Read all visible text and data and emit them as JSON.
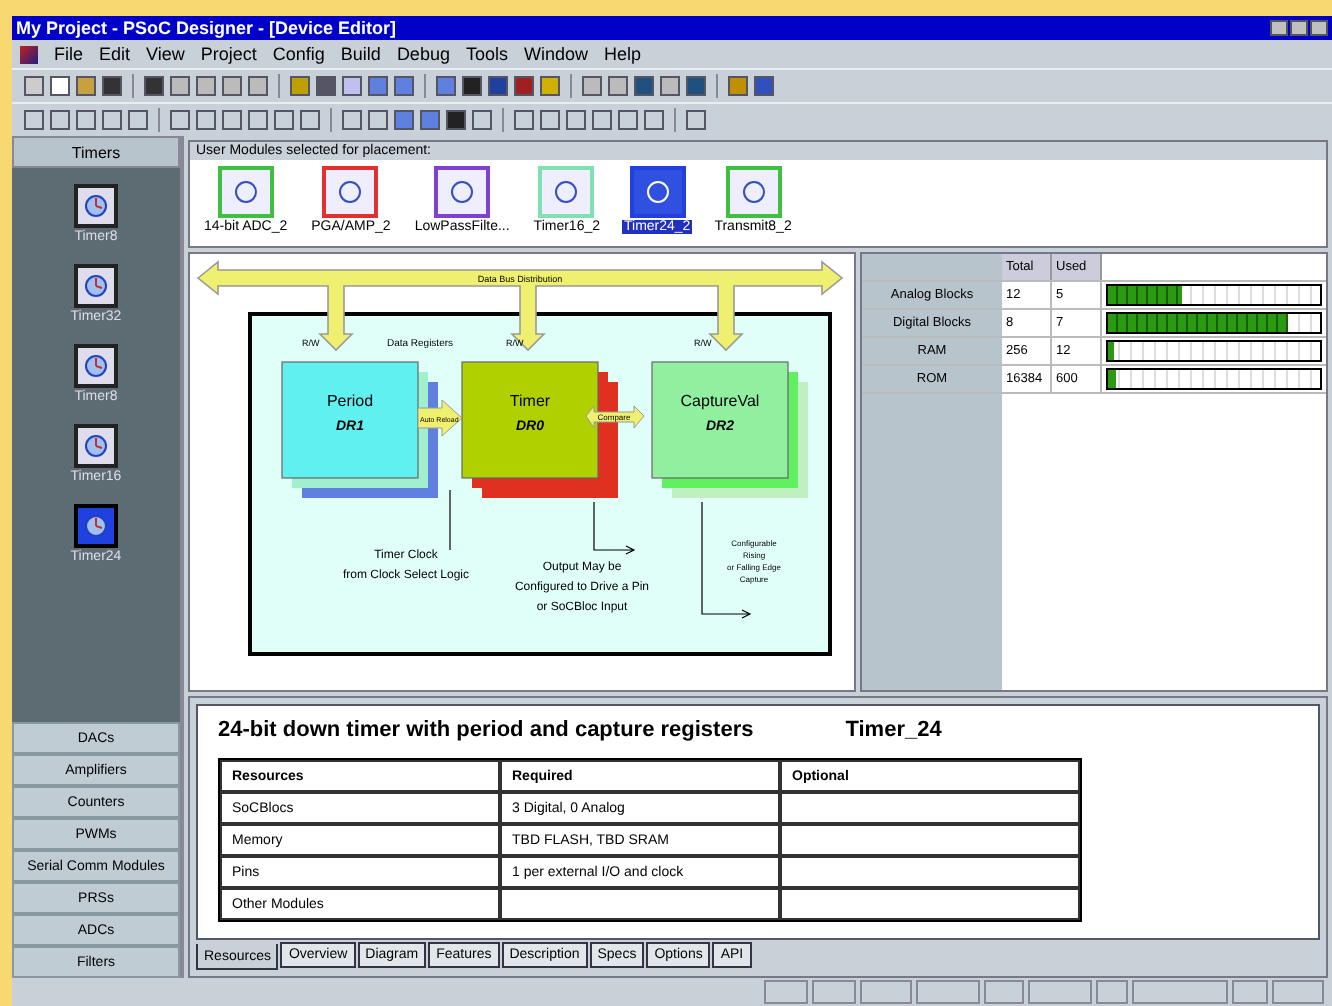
{
  "window": {
    "title": "My Project - PSoC Designer - [Device Editor]"
  },
  "menu": [
    "File",
    "Edit",
    "View",
    "Project",
    "Config",
    "Build",
    "Debug",
    "Tools",
    "Window",
    "Help"
  ],
  "sidebar": {
    "heading": "Timers",
    "items": [
      {
        "label": "Timer8",
        "selected": false
      },
      {
        "label": "Timer32",
        "selected": false
      },
      {
        "label": "Timer8",
        "selected": false
      },
      {
        "label": "Timer16",
        "selected": false
      },
      {
        "label": "Timer24",
        "selected": true
      }
    ],
    "categories": [
      "DACs",
      "Amplifiers",
      "Counters",
      "PWMs",
      "Serial Comm Modules",
      "PRSs",
      "ADCs",
      "Filters"
    ]
  },
  "modules": {
    "heading": "User Modules selected for placement:",
    "items": [
      {
        "label": "14-bit ADC_2",
        "color": "#40c040",
        "selected": false
      },
      {
        "label": "PGA/AMP_2",
        "color": "#e03030",
        "selected": false
      },
      {
        "label": "LowPassFilte...",
        "color": "#8040d0",
        "selected": false
      },
      {
        "label": "Timer16_2",
        "color": "#80e0b0",
        "selected": false
      },
      {
        "label": "Timer24_2",
        "color": "#2040e0",
        "selected": true
      },
      {
        "label": "Transmit8_2",
        "color": "#40c040",
        "selected": false
      }
    ]
  },
  "diagram": {
    "bus": "Data Bus Distribution",
    "registers_label": "Data Registers",
    "rw": [
      "R/W",
      "R/W",
      "R/W"
    ],
    "blocks": [
      {
        "name": "Period",
        "register": "DR1"
      },
      {
        "name": "Timer",
        "register": "DR0"
      },
      {
        "name": "CaptureVal",
        "register": "DR2"
      }
    ],
    "reload": "Auto Reload",
    "compare": "Compare",
    "clock_note": [
      "Timer Clock",
      "from Clock Select Logic"
    ],
    "output_note": [
      "Output May be",
      "Configured to Drive a Pin",
      "or SoCBloc Input"
    ],
    "capture_note": [
      "Configurable",
      "Rising",
      "or Falling Edge",
      "Capture"
    ]
  },
  "resources": {
    "columns": [
      "Total",
      "Used"
    ],
    "rows": [
      {
        "name": "Analog Blocks",
        "total": "12",
        "used": "5",
        "level": 0.35
      },
      {
        "name": "Digital Blocks",
        "total": "8",
        "used": "7",
        "level": 0.85
      },
      {
        "name": "RAM",
        "total": "256",
        "used": "12",
        "level": 0.03
      },
      {
        "name": "ROM",
        "total": "16384",
        "used": "600",
        "level": 0.04
      }
    ]
  },
  "details": {
    "title": "24-bit down timer with period and capture registers",
    "module": "Timer_24",
    "columns": [
      "Resources",
      "Required",
      "Optional"
    ],
    "rows": [
      [
        "SoCBlocs",
        "3 Digital, 0 Analog",
        ""
      ],
      [
        "Memory",
        "TBD FLASH, TBD SRAM",
        ""
      ],
      [
        "Pins",
        "1 per external I/O and clock",
        ""
      ],
      [
        "Other Modules",
        "",
        ""
      ]
    ],
    "tabs": [
      {
        "label": "Resources",
        "selected": true
      },
      {
        "label": "Overview",
        "selected": false
      },
      {
        "label": "Diagram",
        "selected": false
      },
      {
        "label": "Features",
        "selected": false
      },
      {
        "label": "Description",
        "selected": false
      },
      {
        "label": "Specs",
        "selected": false
      },
      {
        "label": "Options",
        "selected": false
      },
      {
        "label": "API",
        "selected": false
      }
    ]
  }
}
